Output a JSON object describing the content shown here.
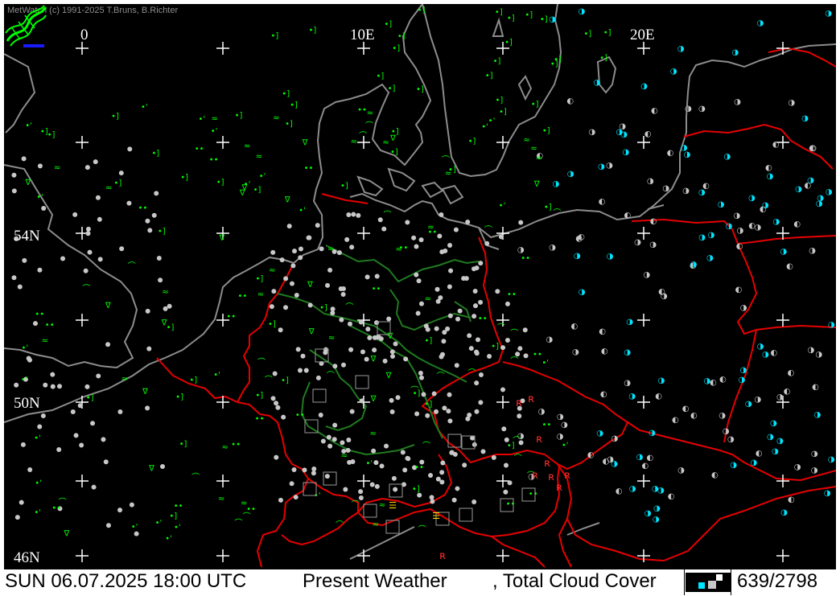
{
  "map": {
    "copyright": "MetWatch  (c) 1991-2025 T.Bruns, B.Richter",
    "lon_labels": [
      "0",
      "10E",
      "20E"
    ],
    "lat_labels": [
      "54N",
      "50N",
      "46N"
    ],
    "colors": {
      "background": "#000000",
      "coastline": "#8c8c8c",
      "borders": "#e60000",
      "inner_borders": "#1f7a1f",
      "weather_symbols": "#00ff00",
      "cloud_symbols": "#c8c8c8",
      "cyan_symbols": "#00e5ff",
      "warning_symbols": "#ff3030",
      "grid_marks": "#ffffff"
    }
  },
  "status": {
    "datetime": "SUN 06.07.2025 18:00 UTC",
    "product": "Present Weather",
    "product2": ", Total Cloud Cover",
    "count": "639/2798"
  }
}
